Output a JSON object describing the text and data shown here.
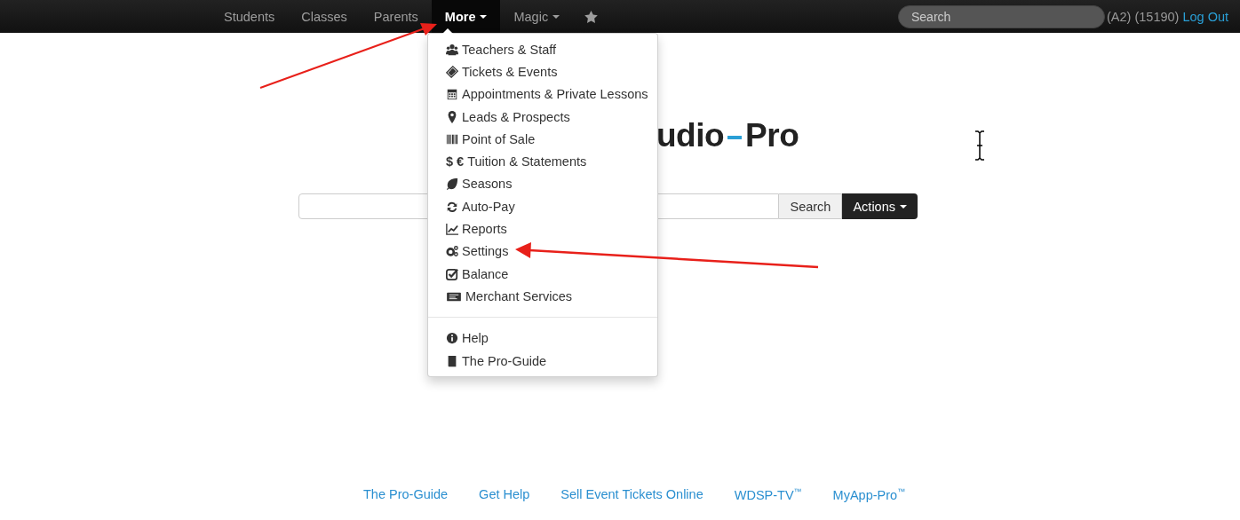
{
  "navbar": {
    "items": [
      {
        "label": "Students",
        "selected": false,
        "dropdown": false
      },
      {
        "label": "Classes",
        "selected": false,
        "dropdown": false
      },
      {
        "label": "Parents",
        "selected": false,
        "dropdown": false
      },
      {
        "label": "More",
        "selected": true,
        "dropdown": true
      },
      {
        "label": "Magic",
        "selected": false,
        "dropdown": true
      }
    ],
    "search": {
      "placeholder": "Search"
    },
    "account": "(A2) (15190)",
    "logout": "Log Out"
  },
  "menu": {
    "groups": [
      [
        {
          "label": "Teachers & Staff"
        },
        {
          "label": "Tickets & Events"
        },
        {
          "label": "Appointments & Private Lessons"
        },
        {
          "label": "Leads & Prospects"
        },
        {
          "label": "Point of Sale"
        },
        {
          "label": "Tuition & Statements",
          "symbol": "$ €"
        },
        {
          "label": "Seasons"
        },
        {
          "label": "Auto-Pay"
        },
        {
          "label": "Reports"
        },
        {
          "label": "Settings"
        },
        {
          "label": "Balance"
        },
        {
          "label": "Merchant Services"
        }
      ],
      [
        {
          "label": "Help"
        },
        {
          "label": "The Pro-Guide"
        }
      ]
    ]
  },
  "logo": {
    "first": "udio",
    "second": "Pro"
  },
  "search_bar": {
    "button": "Search",
    "actions": "Actions"
  },
  "footer": [
    "The Pro-Guide",
    "Get Help",
    "Sell Event Tickets Online",
    "WDSP-TV$^{™}$",
    "MyApp-Pro$^{™}$"
  ]
}
